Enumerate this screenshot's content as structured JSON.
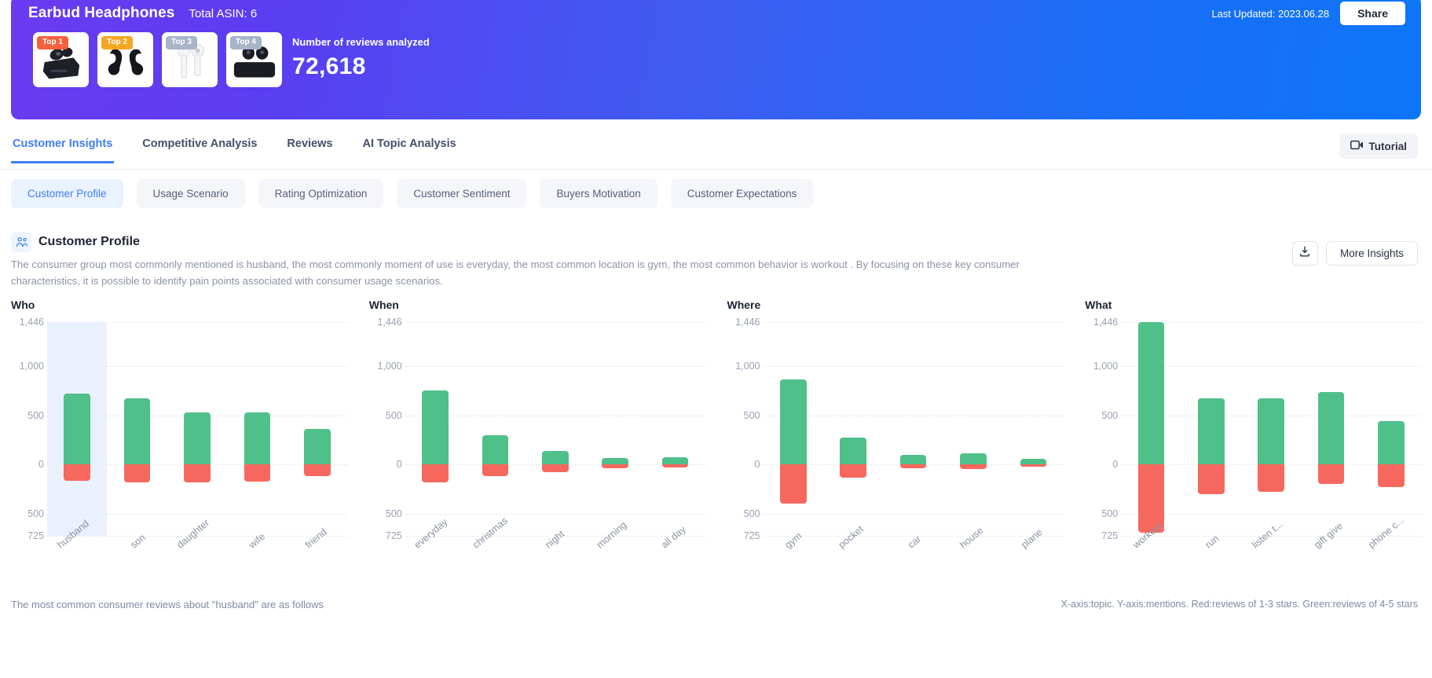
{
  "hero": {
    "title": "Earbud Headphones",
    "asin_label": "Total ASIN: 6",
    "last_updated": "Last Updated: 2023.06.28",
    "share_label": "Share",
    "reviews_label": "Number of reviews analyzed",
    "reviews_count": "72,618",
    "gradient_from": "#6a3bf0",
    "gradient_to": "#0d76f7",
    "thumbs": [
      {
        "badge": "Top 1",
        "badge_color": "#f4603c",
        "icon": "earbuds-case-black-icon"
      },
      {
        "badge": "Top 2",
        "badge_color": "#f5a623",
        "icon": "earhook-earbuds-black-icon"
      },
      {
        "badge": "Top 3",
        "badge_color": "#a8b4c8",
        "icon": "airpods-white-icon"
      },
      {
        "badge": "Top 4",
        "badge_color": "#a8b4c8",
        "icon": "earbuds-case-open-black-icon"
      }
    ]
  },
  "tabs": [
    {
      "label": "Customer Insights",
      "active": true
    },
    {
      "label": "Competitive Analysis",
      "active": false
    },
    {
      "label": "Reviews",
      "active": false
    },
    {
      "label": "AI Topic Analysis",
      "active": false
    }
  ],
  "tutorial": {
    "label": "Tutorial",
    "icon": "video-camera-icon"
  },
  "pills": [
    {
      "label": "Customer Profile",
      "active": true
    },
    {
      "label": "Usage Scenario",
      "active": false
    },
    {
      "label": "Rating Optimization",
      "active": false
    },
    {
      "label": "Customer Sentiment",
      "active": false
    },
    {
      "label": "Buyers Motivation",
      "active": false
    },
    {
      "label": "Customer Expectations",
      "active": false
    }
  ],
  "section": {
    "icon": "people-icon",
    "title": "Customer Profile",
    "description": "The consumer group most commonly mentioned is husband, the most commonly moment of use is everyday, the most common location is gym, the most common behavior is workout . By focusing on these key consumer characteristics, it is possible to identify pain points associated with consumer usage scenarios.",
    "download_icon": "download-icon",
    "more_insights_label": "More Insights"
  },
  "footer": {
    "left": "The most common consumer reviews about \"husband\" are as follows",
    "right": "X-axis:topic. Y-axis:mentions. Red:reviews of 1-3 stars. Green:reviews of 4-5 stars"
  },
  "chart_data": [
    {
      "type": "bar",
      "title": "Who",
      "xlabel": "topic",
      "ylabel": "mentions",
      "ylim": [
        -725,
        1446
      ],
      "yticks": [
        1446,
        1000,
        500,
        0,
        500,
        725
      ],
      "ytick_values": [
        1446,
        1000,
        500,
        0,
        -500,
        -725
      ],
      "grid": true,
      "stacked_diverging": true,
      "highlight_category": "husband",
      "categories": [
        "husband",
        "son",
        "daughter",
        "wife",
        "friend"
      ],
      "series": [
        {
          "name": "reviews of 4-5 stars",
          "color": "#4fc08a",
          "values": [
            720,
            675,
            530,
            532,
            360
          ]
        },
        {
          "name": "reviews of 1-3 stars",
          "color": "#f6685e",
          "values": [
            -168,
            -180,
            -185,
            -178,
            -115
          ]
        }
      ]
    },
    {
      "type": "bar",
      "title": "When",
      "xlabel": "topic",
      "ylabel": "mentions",
      "ylim": [
        -725,
        1446
      ],
      "yticks": [
        1446,
        1000,
        500,
        0,
        500,
        725
      ],
      "ytick_values": [
        1446,
        1000,
        500,
        0,
        -500,
        -725
      ],
      "grid": true,
      "stacked_diverging": true,
      "highlight_category": null,
      "categories": [
        "everyday",
        "christmas",
        "night",
        "morning",
        "all day"
      ],
      "series": [
        {
          "name": "reviews of 4-5 stars",
          "color": "#4fc08a",
          "values": [
            755,
            295,
            135,
            65,
            75
          ]
        },
        {
          "name": "reviews of 1-3 stars",
          "color": "#f6685e",
          "values": [
            -185,
            -120,
            -75,
            -40,
            -30
          ]
        }
      ]
    },
    {
      "type": "bar",
      "title": "Where",
      "xlabel": "topic",
      "ylabel": "mentions",
      "ylim": [
        -725,
        1446
      ],
      "yticks": [
        1446,
        1000,
        500,
        0,
        500,
        725
      ],
      "ytick_values": [
        1446,
        1000,
        500,
        0,
        -500,
        -725
      ],
      "grid": true,
      "stacked_diverging": true,
      "highlight_category": null,
      "categories": [
        "gym",
        "pocket",
        "car",
        "house",
        "plane"
      ],
      "series": [
        {
          "name": "reviews of 4-5 stars",
          "color": "#4fc08a",
          "values": [
            860,
            275,
            100,
            110,
            55
          ]
        },
        {
          "name": "reviews of 1-3 stars",
          "color": "#f6685e",
          "values": [
            -395,
            -135,
            -35,
            -50,
            -25
          ]
        }
      ]
    },
    {
      "type": "bar",
      "title": "What",
      "xlabel": "topic",
      "ylabel": "mentions",
      "ylim": [
        -725,
        1446
      ],
      "yticks": [
        1446,
        1000,
        500,
        0,
        500,
        725
      ],
      "ytick_values": [
        1446,
        1000,
        500,
        0,
        -500,
        -725
      ],
      "grid": true,
      "stacked_diverging": true,
      "highlight_category": null,
      "categories": [
        "workout",
        "run",
        "listen t...",
        "gift give",
        "phone c..."
      ],
      "series": [
        {
          "name": "reviews of 4-5 stars",
          "color": "#4fc08a",
          "values": [
            1446,
            675,
            670,
            735,
            440
          ]
        },
        {
          "name": "reviews of 1-3 stars",
          "color": "#f6685e",
          "values": [
            -690,
            -300,
            -280,
            -200,
            -230
          ]
        }
      ]
    }
  ]
}
